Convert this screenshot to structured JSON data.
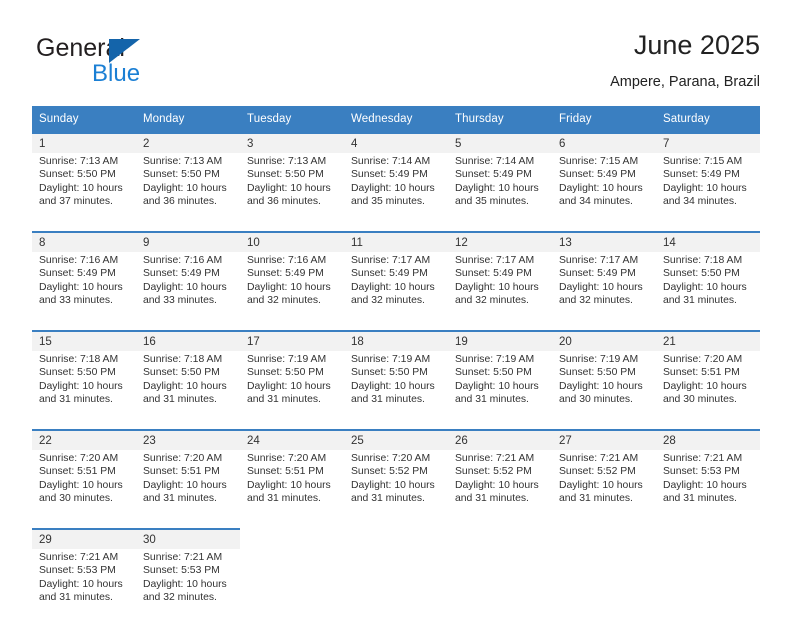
{
  "brand": {
    "name_part1": "General",
    "name_part2": "Blue",
    "triangle_color": "#1464aa",
    "blue_color": "#1b7fd4"
  },
  "header": {
    "title": "June 2025",
    "location": "Ampere, Parana, Brazil"
  },
  "theme": {
    "header_bar_color": "#3a7fc1",
    "daynum_bg": "#f2f2f2",
    "text_color": "#333333"
  },
  "weekdays": [
    "Sunday",
    "Monday",
    "Tuesday",
    "Wednesday",
    "Thursday",
    "Friday",
    "Saturday"
  ],
  "weeks": [
    {
      "days": [
        {
          "num": "1",
          "sunrise": "Sunrise: 7:13 AM",
          "sunset": "Sunset: 5:50 PM",
          "daylight1": "Daylight: 10 hours",
          "daylight2": "and 37 minutes."
        },
        {
          "num": "2",
          "sunrise": "Sunrise: 7:13 AM",
          "sunset": "Sunset: 5:50 PM",
          "daylight1": "Daylight: 10 hours",
          "daylight2": "and 36 minutes."
        },
        {
          "num": "3",
          "sunrise": "Sunrise: 7:13 AM",
          "sunset": "Sunset: 5:50 PM",
          "daylight1": "Daylight: 10 hours",
          "daylight2": "and 36 minutes."
        },
        {
          "num": "4",
          "sunrise": "Sunrise: 7:14 AM",
          "sunset": "Sunset: 5:49 PM",
          "daylight1": "Daylight: 10 hours",
          "daylight2": "and 35 minutes."
        },
        {
          "num": "5",
          "sunrise": "Sunrise: 7:14 AM",
          "sunset": "Sunset: 5:49 PM",
          "daylight1": "Daylight: 10 hours",
          "daylight2": "and 35 minutes."
        },
        {
          "num": "6",
          "sunrise": "Sunrise: 7:15 AM",
          "sunset": "Sunset: 5:49 PM",
          "daylight1": "Daylight: 10 hours",
          "daylight2": "and 34 minutes."
        },
        {
          "num": "7",
          "sunrise": "Sunrise: 7:15 AM",
          "sunset": "Sunset: 5:49 PM",
          "daylight1": "Daylight: 10 hours",
          "daylight2": "and 34 minutes."
        }
      ]
    },
    {
      "days": [
        {
          "num": "8",
          "sunrise": "Sunrise: 7:16 AM",
          "sunset": "Sunset: 5:49 PM",
          "daylight1": "Daylight: 10 hours",
          "daylight2": "and 33 minutes."
        },
        {
          "num": "9",
          "sunrise": "Sunrise: 7:16 AM",
          "sunset": "Sunset: 5:49 PM",
          "daylight1": "Daylight: 10 hours",
          "daylight2": "and 33 minutes."
        },
        {
          "num": "10",
          "sunrise": "Sunrise: 7:16 AM",
          "sunset": "Sunset: 5:49 PM",
          "daylight1": "Daylight: 10 hours",
          "daylight2": "and 32 minutes."
        },
        {
          "num": "11",
          "sunrise": "Sunrise: 7:17 AM",
          "sunset": "Sunset: 5:49 PM",
          "daylight1": "Daylight: 10 hours",
          "daylight2": "and 32 minutes."
        },
        {
          "num": "12",
          "sunrise": "Sunrise: 7:17 AM",
          "sunset": "Sunset: 5:49 PM",
          "daylight1": "Daylight: 10 hours",
          "daylight2": "and 32 minutes."
        },
        {
          "num": "13",
          "sunrise": "Sunrise: 7:17 AM",
          "sunset": "Sunset: 5:49 PM",
          "daylight1": "Daylight: 10 hours",
          "daylight2": "and 32 minutes."
        },
        {
          "num": "14",
          "sunrise": "Sunrise: 7:18 AM",
          "sunset": "Sunset: 5:50 PM",
          "daylight1": "Daylight: 10 hours",
          "daylight2": "and 31 minutes."
        }
      ]
    },
    {
      "days": [
        {
          "num": "15",
          "sunrise": "Sunrise: 7:18 AM",
          "sunset": "Sunset: 5:50 PM",
          "daylight1": "Daylight: 10 hours",
          "daylight2": "and 31 minutes."
        },
        {
          "num": "16",
          "sunrise": "Sunrise: 7:18 AM",
          "sunset": "Sunset: 5:50 PM",
          "daylight1": "Daylight: 10 hours",
          "daylight2": "and 31 minutes."
        },
        {
          "num": "17",
          "sunrise": "Sunrise: 7:19 AM",
          "sunset": "Sunset: 5:50 PM",
          "daylight1": "Daylight: 10 hours",
          "daylight2": "and 31 minutes."
        },
        {
          "num": "18",
          "sunrise": "Sunrise: 7:19 AM",
          "sunset": "Sunset: 5:50 PM",
          "daylight1": "Daylight: 10 hours",
          "daylight2": "and 31 minutes."
        },
        {
          "num": "19",
          "sunrise": "Sunrise: 7:19 AM",
          "sunset": "Sunset: 5:50 PM",
          "daylight1": "Daylight: 10 hours",
          "daylight2": "and 31 minutes."
        },
        {
          "num": "20",
          "sunrise": "Sunrise: 7:19 AM",
          "sunset": "Sunset: 5:50 PM",
          "daylight1": "Daylight: 10 hours",
          "daylight2": "and 30 minutes."
        },
        {
          "num": "21",
          "sunrise": "Sunrise: 7:20 AM",
          "sunset": "Sunset: 5:51 PM",
          "daylight1": "Daylight: 10 hours",
          "daylight2": "and 30 minutes."
        }
      ]
    },
    {
      "days": [
        {
          "num": "22",
          "sunrise": "Sunrise: 7:20 AM",
          "sunset": "Sunset: 5:51 PM",
          "daylight1": "Daylight: 10 hours",
          "daylight2": "and 30 minutes."
        },
        {
          "num": "23",
          "sunrise": "Sunrise: 7:20 AM",
          "sunset": "Sunset: 5:51 PM",
          "daylight1": "Daylight: 10 hours",
          "daylight2": "and 31 minutes."
        },
        {
          "num": "24",
          "sunrise": "Sunrise: 7:20 AM",
          "sunset": "Sunset: 5:51 PM",
          "daylight1": "Daylight: 10 hours",
          "daylight2": "and 31 minutes."
        },
        {
          "num": "25",
          "sunrise": "Sunrise: 7:20 AM",
          "sunset": "Sunset: 5:52 PM",
          "daylight1": "Daylight: 10 hours",
          "daylight2": "and 31 minutes."
        },
        {
          "num": "26",
          "sunrise": "Sunrise: 7:21 AM",
          "sunset": "Sunset: 5:52 PM",
          "daylight1": "Daylight: 10 hours",
          "daylight2": "and 31 minutes."
        },
        {
          "num": "27",
          "sunrise": "Sunrise: 7:21 AM",
          "sunset": "Sunset: 5:52 PM",
          "daylight1": "Daylight: 10 hours",
          "daylight2": "and 31 minutes."
        },
        {
          "num": "28",
          "sunrise": "Sunrise: 7:21 AM",
          "sunset": "Sunset: 5:53 PM",
          "daylight1": "Daylight: 10 hours",
          "daylight2": "and 31 minutes."
        }
      ]
    },
    {
      "days": [
        {
          "num": "29",
          "sunrise": "Sunrise: 7:21 AM",
          "sunset": "Sunset: 5:53 PM",
          "daylight1": "Daylight: 10 hours",
          "daylight2": "and 31 minutes."
        },
        {
          "num": "30",
          "sunrise": "Sunrise: 7:21 AM",
          "sunset": "Sunset: 5:53 PM",
          "daylight1": "Daylight: 10 hours",
          "daylight2": "and 32 minutes."
        },
        {
          "num": "",
          "sunrise": "",
          "sunset": "",
          "daylight1": "",
          "daylight2": ""
        },
        {
          "num": "",
          "sunrise": "",
          "sunset": "",
          "daylight1": "",
          "daylight2": ""
        },
        {
          "num": "",
          "sunrise": "",
          "sunset": "",
          "daylight1": "",
          "daylight2": ""
        },
        {
          "num": "",
          "sunrise": "",
          "sunset": "",
          "daylight1": "",
          "daylight2": ""
        },
        {
          "num": "",
          "sunrise": "",
          "sunset": "",
          "daylight1": "",
          "daylight2": ""
        }
      ]
    }
  ]
}
